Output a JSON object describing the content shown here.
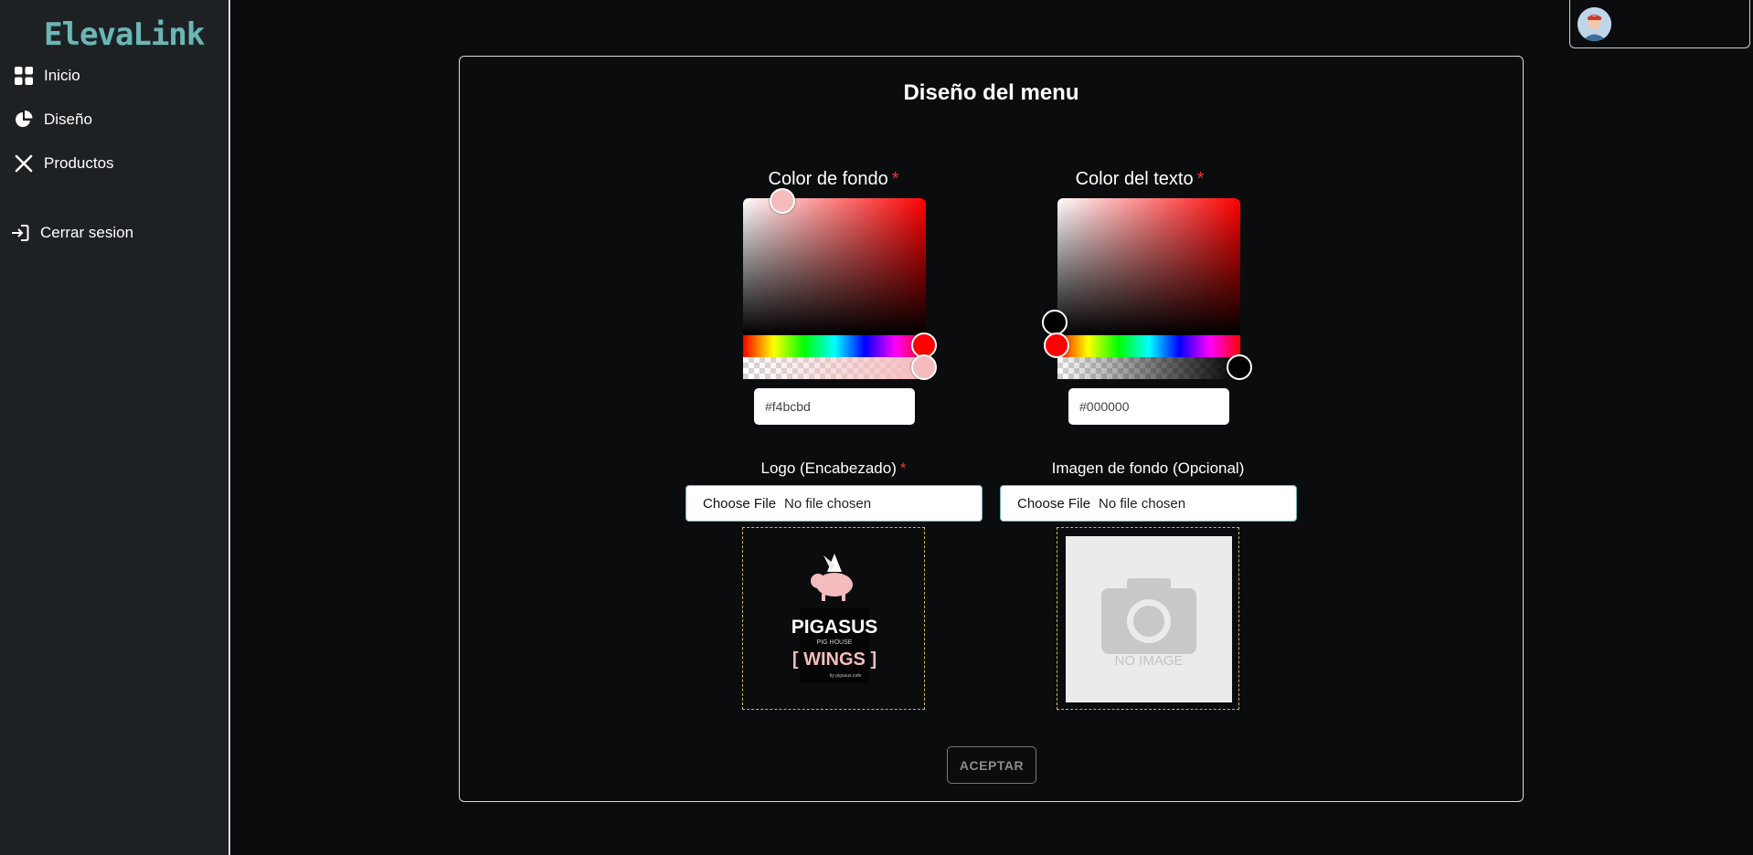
{
  "app": {
    "logo_text": "ElevaLink"
  },
  "sidebar": {
    "items": [
      {
        "label": "Inicio",
        "icon": "grid-icon"
      },
      {
        "label": "Diseño",
        "icon": "pie-chart-icon"
      },
      {
        "label": "Productos",
        "icon": "utensils-icon"
      }
    ],
    "logout": {
      "label": "Cerrar sesion",
      "icon": "logout-icon"
    }
  },
  "card": {
    "title": "Diseño del menu",
    "bg_color": {
      "label": "Color de fondo",
      "required": "*",
      "value": "#f4bcbd",
      "hue_color": "#ff0000"
    },
    "text_color": {
      "label": "Color del texto",
      "required": "*",
      "value": "#000000",
      "hue_color": "#ff0000"
    },
    "logo_upload": {
      "label": "Logo (Encabezado)",
      "required": "*",
      "button": "Choose File",
      "status": "No file chosen",
      "preview_text": {
        "line1": "PIGASUS",
        "line2": "PIG HOUSE",
        "line3": "[ WINGS ]",
        "line4": "by pigasus.cafe"
      }
    },
    "bg_upload": {
      "label": "Imagen de fondo (Opcional)",
      "button": "Choose File",
      "status": "No file chosen",
      "placeholder": "NO IMAGE"
    },
    "accept_label": "ACEPTAR"
  }
}
